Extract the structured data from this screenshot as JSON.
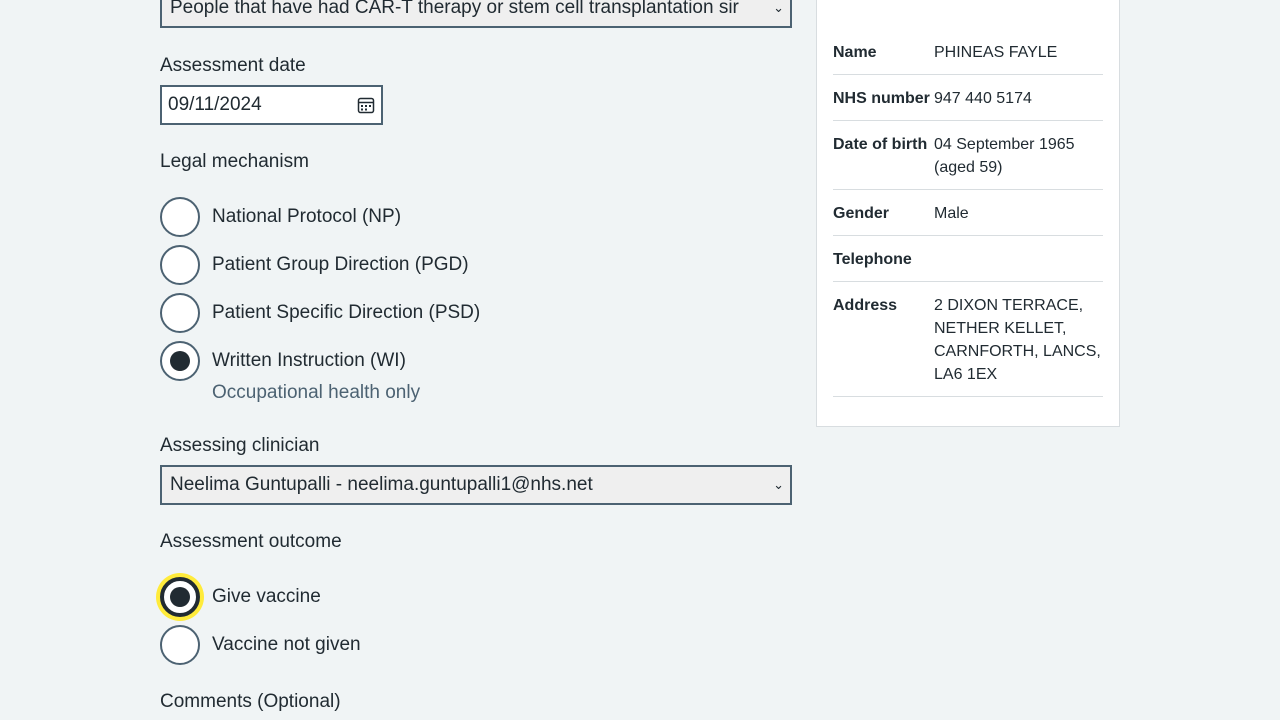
{
  "group_select": {
    "value": "People that have had CAR-T therapy or stem cell transplantation sir"
  },
  "assessment_date": {
    "label": "Assessment date",
    "value": "09/11/2024"
  },
  "legal_mechanism": {
    "label": "Legal mechanism",
    "options": [
      {
        "label": "National Protocol (NP)",
        "checked": false
      },
      {
        "label": "Patient Group Direction (PGD)",
        "checked": false
      },
      {
        "label": "Patient Specific Direction (PSD)",
        "checked": false
      },
      {
        "label": "Written Instruction (WI)",
        "checked": true,
        "hint": "Occupational health only"
      }
    ]
  },
  "assessing_clinician": {
    "label": "Assessing clinician",
    "value": "Neelima Guntupalli - neelima.guntupalli1@nhs.net"
  },
  "assessment_outcome": {
    "label": "Assessment outcome",
    "options": [
      {
        "label": "Give vaccine",
        "checked": true,
        "focused": true
      },
      {
        "label": "Vaccine not given",
        "checked": false
      }
    ]
  },
  "comments": {
    "label": "Comments (Optional)"
  },
  "patient": {
    "rows": [
      {
        "key": "Name",
        "value": "PHINEAS FAYLE"
      },
      {
        "key": "NHS number",
        "value": "947 440 5174"
      },
      {
        "key": "Date of birth",
        "value": "04 September 1965 (aged 59)"
      },
      {
        "key": "Gender",
        "value": "Male"
      },
      {
        "key": "Telephone",
        "value": ""
      },
      {
        "key": "Address",
        "value": "2 DIXON TERRACE, NETHER KELLET, CARNFORTH, LANCS, LA6 1EX"
      }
    ]
  },
  "colors": {
    "background": "#f0f4f5",
    "text": "#212b32",
    "border": "#4c6272",
    "focus": "#ffeb3b"
  }
}
